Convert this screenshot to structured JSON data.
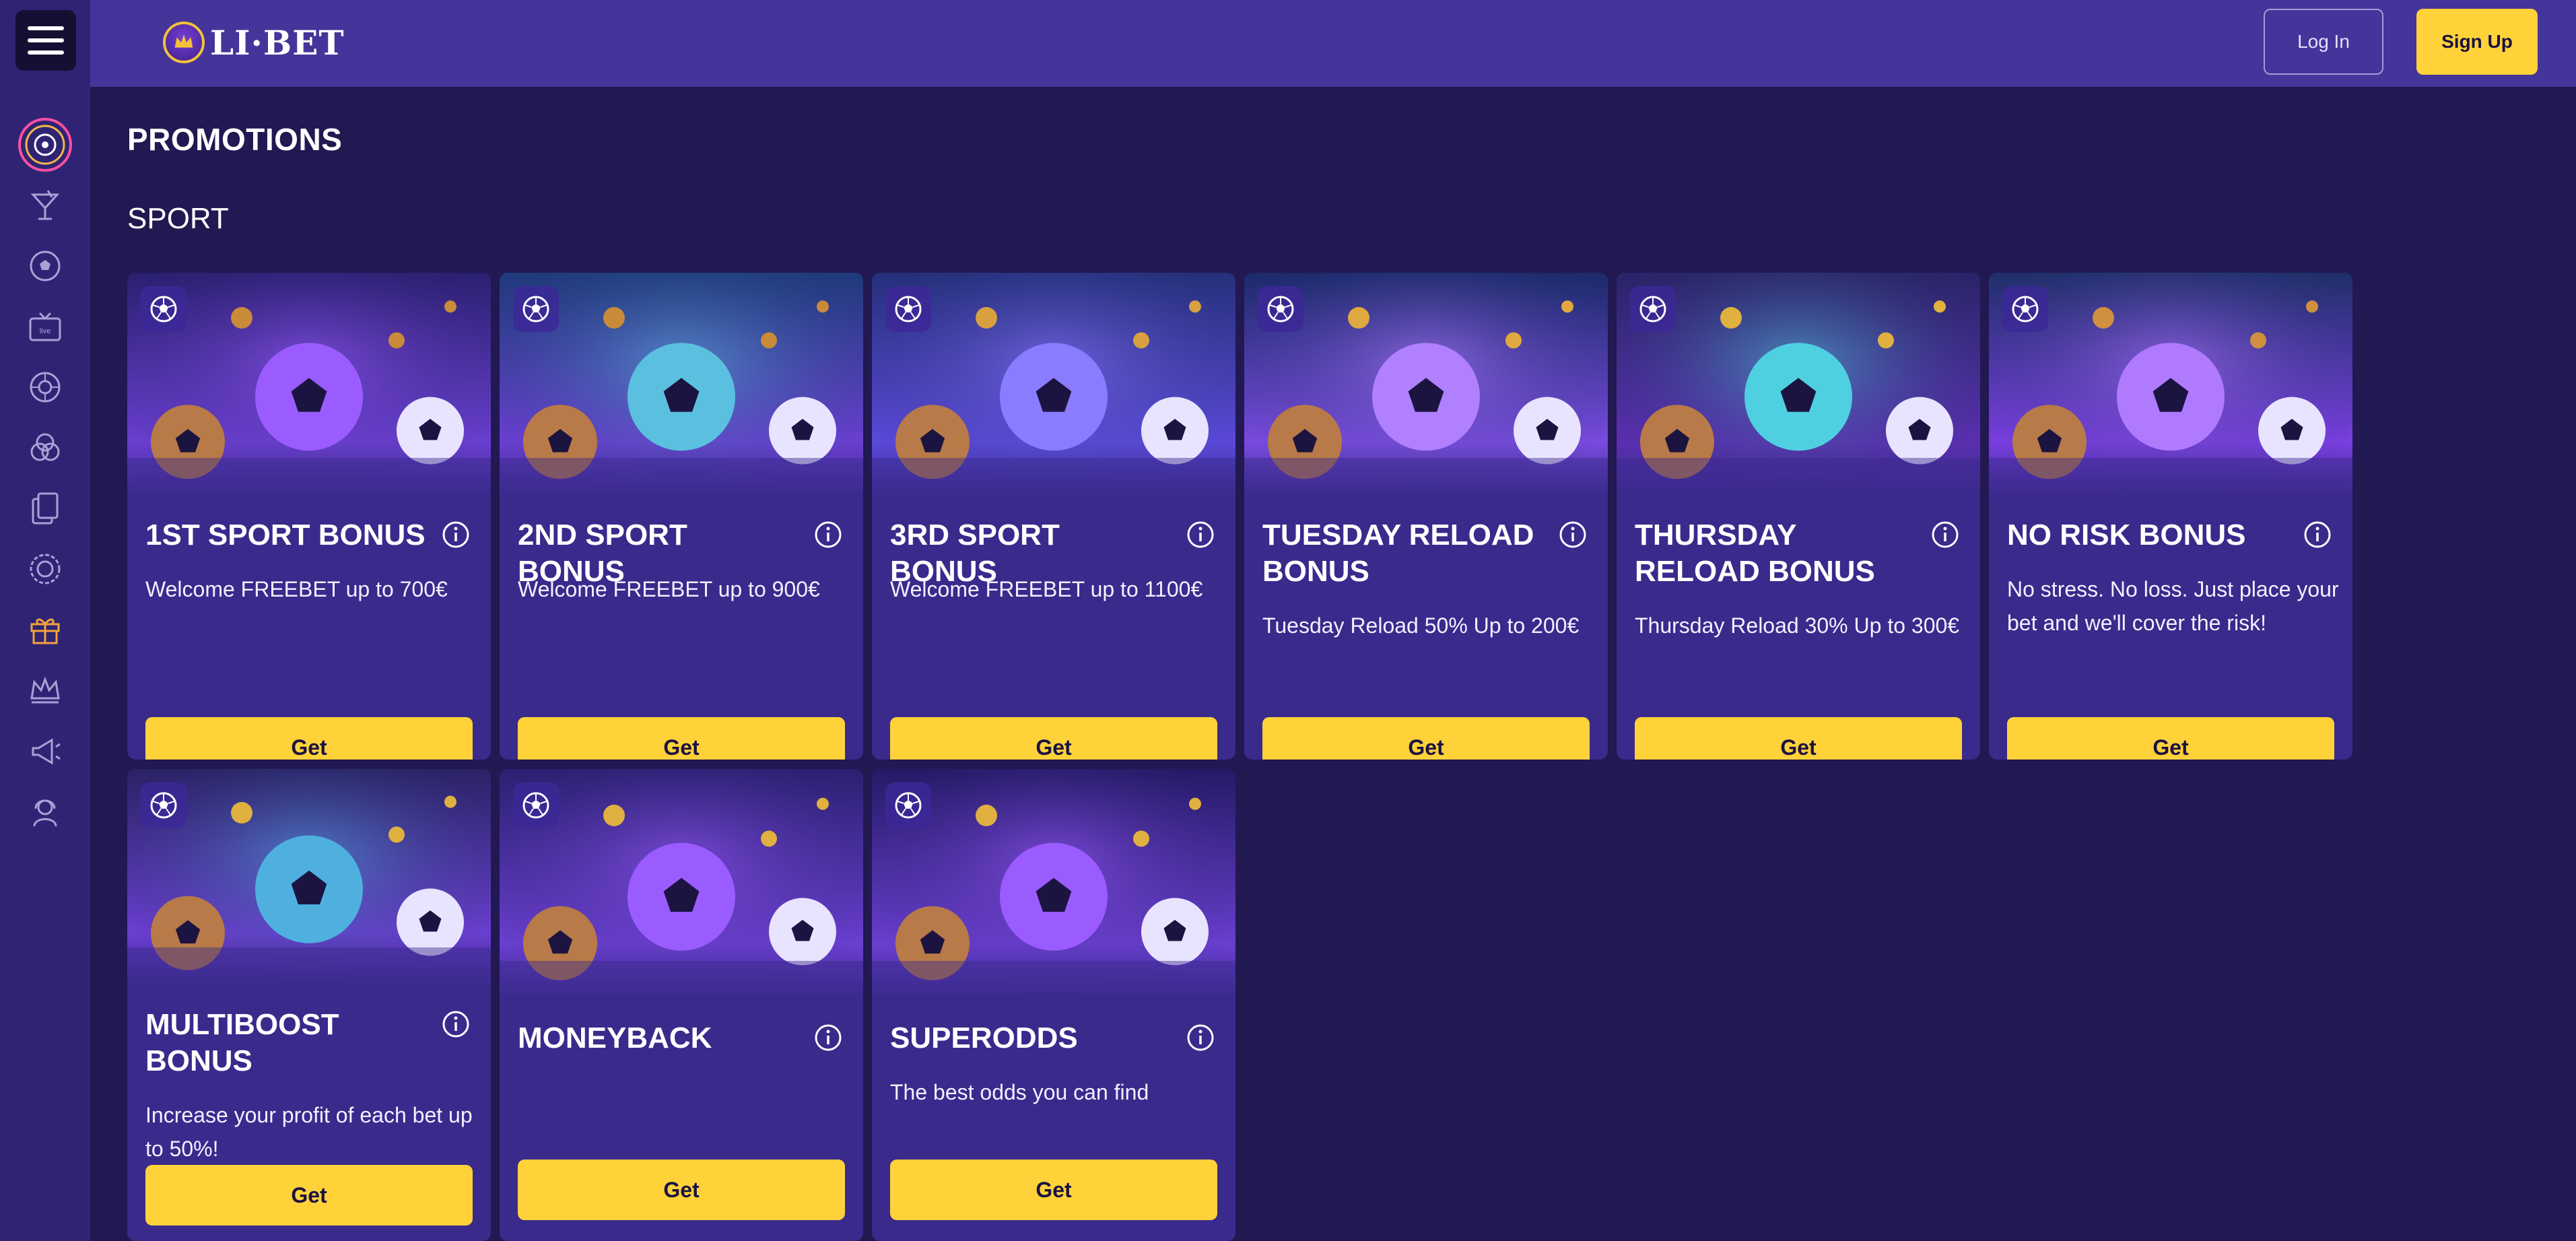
{
  "header": {
    "logo_text": "LI·BET",
    "login_label": "Log In",
    "signup_label": "Sign Up"
  },
  "page": {
    "title": "PROMOTIONS",
    "section": "SPORT"
  },
  "sidebar": {
    "items": [
      {
        "icon": "target-icon",
        "active": true
      },
      {
        "icon": "cocktail-icon"
      },
      {
        "icon": "soccer-ball-icon"
      },
      {
        "icon": "live-tv-icon"
      },
      {
        "icon": "roulette-icon"
      },
      {
        "icon": "poker-chips-icon"
      },
      {
        "icon": "cards-icon"
      },
      {
        "icon": "wheel-icon"
      },
      {
        "icon": "gift-icon",
        "highlight": true
      },
      {
        "icon": "crown-icon"
      },
      {
        "icon": "megaphone-icon"
      },
      {
        "icon": "support-agent-icon"
      }
    ]
  },
  "cards": [
    {
      "title": "1ST SPORT BONUS",
      "desc": "Welcome FREEBET up to 700€",
      "button": "Get"
    },
    {
      "title": "2ND SPORT BONUS",
      "desc": "Welcome FREEBET up to 900€",
      "button": "Get"
    },
    {
      "title": "3RD SPORT BONUS",
      "desc": "Welcome FREEBET up to 1100€",
      "button": "Get"
    },
    {
      "title": "TUESDAY RELOAD BONUS",
      "desc": "Tuesday Reload 50% Up to 200€",
      "button": "Get"
    },
    {
      "title": "THURSDAY RELOAD BONUS",
      "desc": "Thursday Reload 30% Up to 300€",
      "button": "Get"
    },
    {
      "title": "NO RISK BONUS",
      "desc": "No stress. No loss. Just place your bet and we'll cover the risk!",
      "button": "Get"
    },
    {
      "title": "MULTIBOOST BONUS",
      "desc": "Increase your profit of each bet up to 50%!",
      "button": "Get"
    },
    {
      "title": "MONEYBACK",
      "desc": "",
      "button": "Get"
    },
    {
      "title": "SUPERODDS",
      "desc": "The best odds you can find",
      "button": "Get"
    }
  ],
  "colors": {
    "background": "#221852",
    "sidebar": "#2f2474",
    "header": "#45349a",
    "card": "#3a2a8c",
    "accent_yellow": "#ffd23a",
    "active_ring": "#e0409a"
  }
}
